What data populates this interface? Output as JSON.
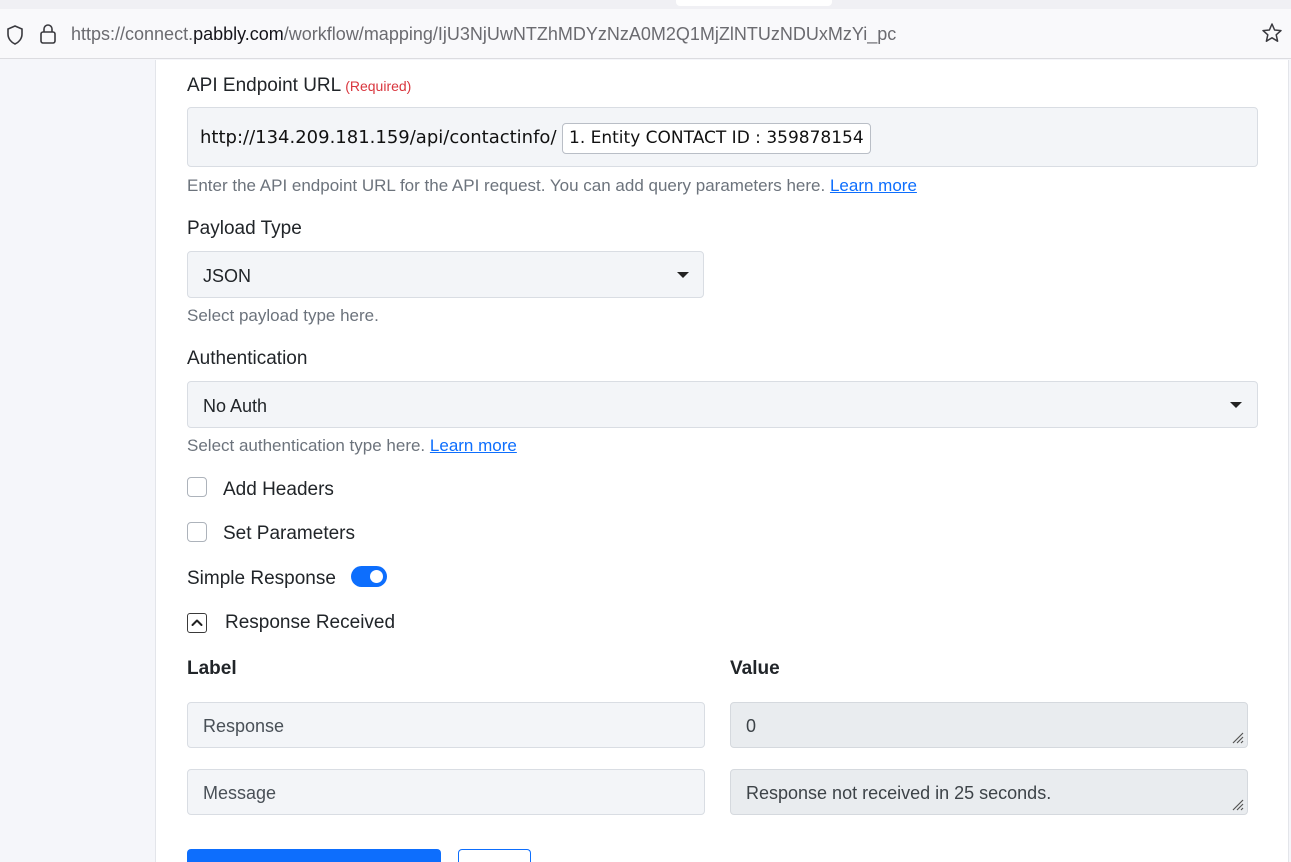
{
  "browser": {
    "url_prefix": "https://connect.",
    "url_domain": "pabbly.com",
    "url_path": "/workflow/mapping/IjU3NjUwNTZhMDYzNzA0M2Q1MjZlNTUzNDUxMzYi_pc"
  },
  "form": {
    "endpoint": {
      "label": "API Endpoint URL",
      "required": "(Required)",
      "url_text": "http://134.209.181.159/api/contactinfo/",
      "chip": "1. Entity CONTACT ID : 359878154",
      "help": "Enter the API endpoint URL for the API request. You can add query parameters here.",
      "learn_more": "Learn more"
    },
    "payload": {
      "label": "Payload Type",
      "value": "JSON",
      "help": "Select payload type here."
    },
    "auth": {
      "label": "Authentication",
      "value": "No Auth",
      "help": "Select authentication type here.",
      "learn_more": "Learn more"
    },
    "add_headers": {
      "label": "Add Headers",
      "checked": false
    },
    "set_parameters": {
      "label": "Set Parameters",
      "checked": false
    },
    "simple_response": {
      "label": "Simple Response",
      "on": true
    },
    "response_received": {
      "label": "Response Received",
      "expanded": true
    },
    "table": {
      "label_header": "Label",
      "value_header": "Value",
      "rows": [
        {
          "label": "Response",
          "value": "0"
        },
        {
          "label": "Message",
          "value": "Response not received in 25 seconds."
        }
      ]
    }
  },
  "colors": {
    "accent": "#0d6efd",
    "required": "#d9363e"
  }
}
